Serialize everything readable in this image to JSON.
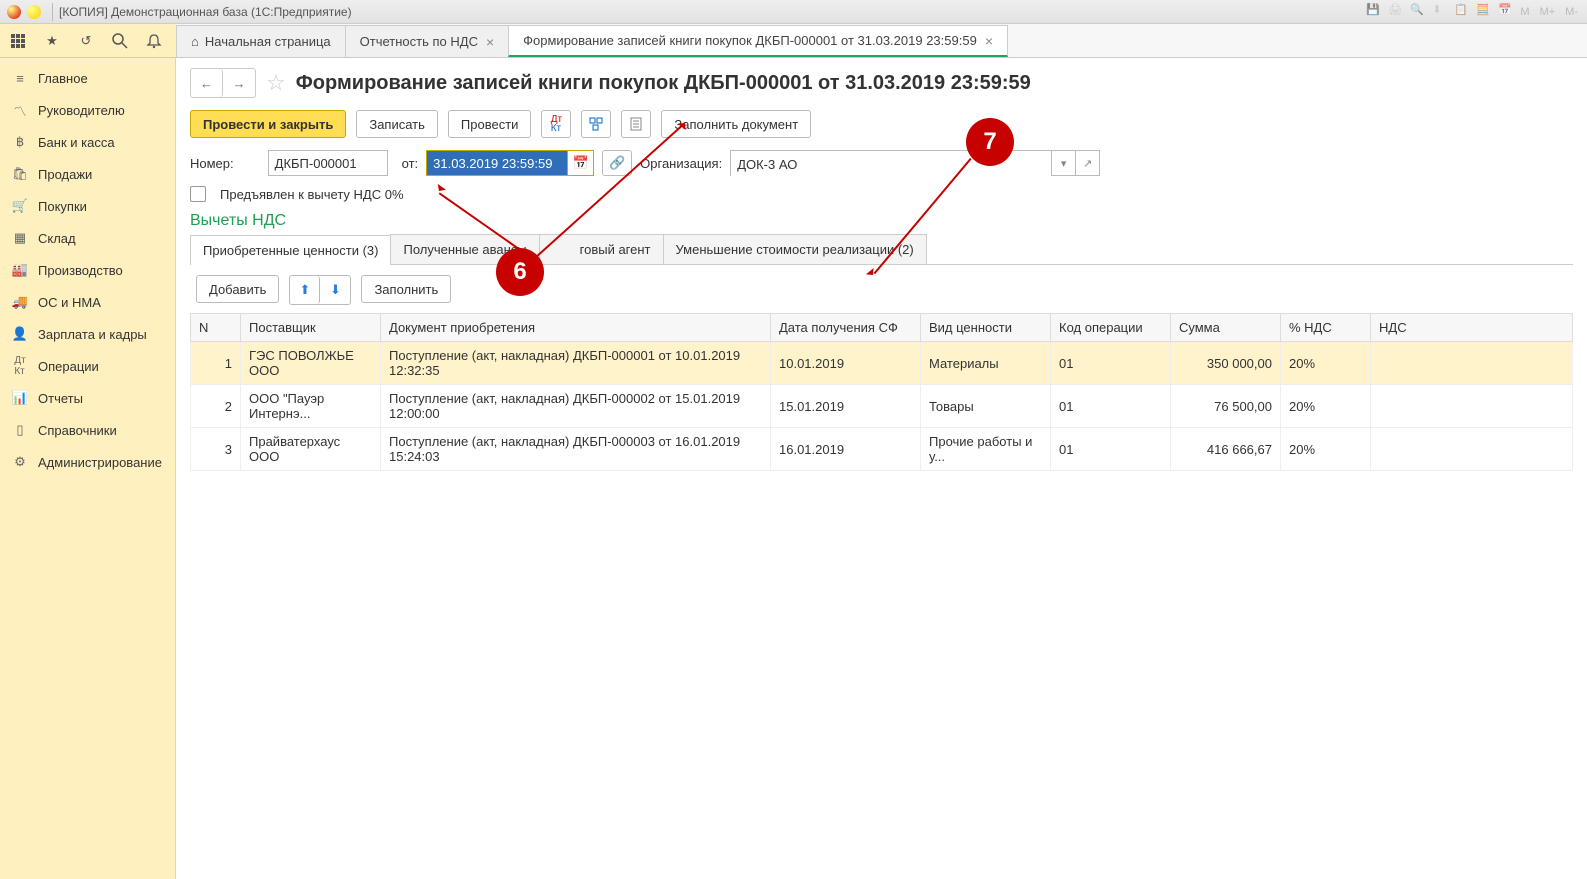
{
  "titlebar": {
    "text": "[КОПИЯ] Демонстрационная база  (1С:Предприятие)",
    "right_icons": [
      "save-icon",
      "print-icon",
      "preview-icon",
      "download-icon",
      "copy-icon",
      "calc-icon",
      "calendar-icon"
    ],
    "right_labels": [
      "M",
      "M+",
      "M-"
    ]
  },
  "tabs": [
    {
      "label": "Начальная страница",
      "icon": "home-icon",
      "closable": false
    },
    {
      "label": "Отчетность по НДС",
      "closable": true
    },
    {
      "label": "Формирование записей книги покупок ДКБП-000001 от 31.03.2019 23:59:59",
      "closable": true,
      "active": true
    }
  ],
  "sidebar": [
    {
      "icon": "menu-icon",
      "label": "Главное"
    },
    {
      "icon": "chart-icon",
      "label": "Руководителю"
    },
    {
      "icon": "bank-icon",
      "label": "Банк и касса"
    },
    {
      "icon": "bag-icon",
      "label": "Продажи"
    },
    {
      "icon": "cart-icon",
      "label": "Покупки"
    },
    {
      "icon": "warehouse-icon",
      "label": "Склад"
    },
    {
      "icon": "factory-icon",
      "label": "Производство"
    },
    {
      "icon": "truck-icon",
      "label": "ОС и НМА"
    },
    {
      "icon": "people-icon",
      "label": "Зарплата и кадры"
    },
    {
      "icon": "dtkt-icon",
      "label": "Операции"
    },
    {
      "icon": "bars-icon",
      "label": "Отчеты"
    },
    {
      "icon": "book-icon",
      "label": "Справочники"
    },
    {
      "icon": "gear-icon",
      "label": "Администрирование"
    }
  ],
  "page": {
    "title": "Формирование записей книги покупок ДКБП-000001 от 31.03.2019 23:59:59",
    "toolbar": {
      "post_close": "Провести и закрыть",
      "write": "Записать",
      "post": "Провести",
      "fill_doc": "Заполнить документ"
    },
    "fields": {
      "number_label": "Номер:",
      "number_value": "ДКБП-000001",
      "date_label": "от:",
      "date_value": "31.03.2019 23:59:59",
      "org_label": "Организация:",
      "org_value": "ДОК-3 АО",
      "chk_label": "Предъявлен к вычету НДС 0%"
    },
    "section": "Вычеты НДС",
    "subtabs": [
      {
        "label": "Приобретенные ценности (3)",
        "active": true
      },
      {
        "label": "Полученные авансы"
      },
      {
        "label": "говый агент",
        "partial": true
      },
      {
        "label": "Уменьшение стоимости реализации (2)"
      }
    ],
    "tab_toolbar": {
      "add": "Добавить",
      "fill": "Заполнить"
    },
    "columns": [
      "N",
      "Поставщик",
      "Документ приобретения",
      "Дата получения СФ",
      "Вид ценности",
      "Код операции",
      "Сумма",
      "% НДС",
      "НДС"
    ],
    "rows": [
      {
        "n": "1",
        "supplier": "ГЭС ПОВОЛЖЬЕ ООО",
        "doc": "Поступление (акт, накладная) ДКБП-000001 от 10.01.2019 12:32:35",
        "date": "10.01.2019",
        "type": "Материалы",
        "op": "01",
        "sum": "350 000,00",
        "vat": "20%",
        "vat_sum": "",
        "selected": true
      },
      {
        "n": "2",
        "supplier": "ООО \"Пауэр Интернэ...",
        "doc": "Поступление (акт, накладная) ДКБП-000002 от 15.01.2019 12:00:00",
        "date": "15.01.2019",
        "type": "Товары",
        "op": "01",
        "sum": "76 500,00",
        "vat": "20%",
        "vat_sum": ""
      },
      {
        "n": "3",
        "supplier": "Прайватерхаус ООО",
        "doc": "Поступление (акт, накладная) ДКБП-000003 от 16.01.2019 15:24:03",
        "date": "16.01.2019",
        "type": "Прочие работы и у...",
        "op": "01",
        "sum": "416 666,67",
        "vat": "20%",
        "vat_sum": ""
      }
    ]
  },
  "callouts": {
    "c6": "6",
    "c7": "7"
  }
}
